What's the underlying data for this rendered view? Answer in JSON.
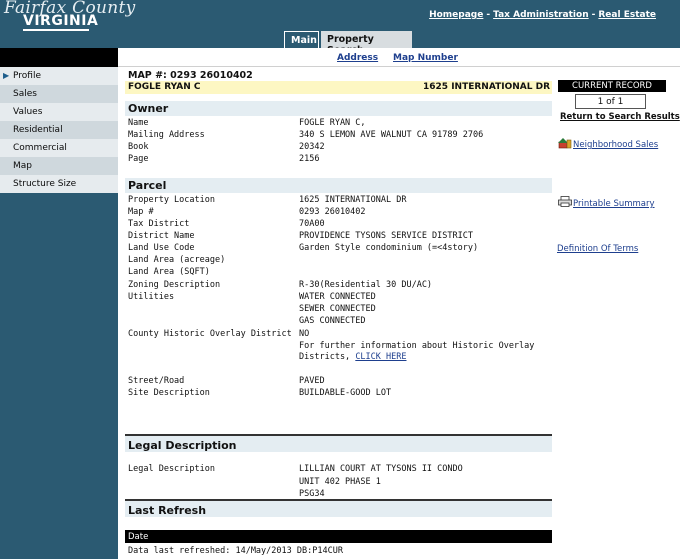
{
  "header": {
    "logo_county": "Fairfax County",
    "logo_state": "VIRGINIA",
    "nav": [
      "Homepage",
      "Tax Administration",
      "Real Estate"
    ],
    "tabs": [
      "Main",
      "Property Search"
    ]
  },
  "subnav": {
    "address": "Address",
    "map_number": "Map Number"
  },
  "sidebar": {
    "items": [
      {
        "label": "Profile"
      },
      {
        "label": "Sales"
      },
      {
        "label": "Values"
      },
      {
        "label": "Residential"
      },
      {
        "label": "Commercial"
      },
      {
        "label": "Map"
      },
      {
        "label": "Structure Size"
      }
    ]
  },
  "record": {
    "map_label": "MAP #: 0293 26010402",
    "owner_name": "FOGLE RYAN C",
    "address": "1625 INTERNATIONAL DR"
  },
  "owner": {
    "title": "Owner",
    "rows": [
      {
        "k": "Name",
        "v": "FOGLE RYAN C,"
      },
      {
        "k": "Mailing Address",
        "v": "340 S LEMON AVE WALNUT CA 91789 2706"
      },
      {
        "k": "Book",
        "v": "20342"
      },
      {
        "k": "Page",
        "v": "2156"
      }
    ]
  },
  "parcel": {
    "title": "Parcel",
    "rows": [
      {
        "k": "Property Location",
        "v": "1625 INTERNATIONAL DR"
      },
      {
        "k": "Map #",
        "v": "0293 26010402"
      },
      {
        "k": "Tax District",
        "v": "70A00"
      },
      {
        "k": "District Name",
        "v": "PROVIDENCE TYSONS SERVICE DISTRICT"
      },
      {
        "k": "Land Use Code",
        "v": "Garden Style condominium (=<4story)"
      },
      {
        "k": "Land Area (acreage)",
        "v": ""
      },
      {
        "k": "Land Area (SQFT)",
        "v": ""
      },
      {
        "k": "Zoning Description",
        "v": "R-30(Residential 30 DU/AC)"
      },
      {
        "k": "Utilities",
        "v": "WATER CONNECTED"
      },
      {
        "k": "",
        "v": "SEWER CONNECTED"
      },
      {
        "k": "",
        "v": "GAS CONNECTED"
      },
      {
        "k": "County Historic Overlay District",
        "v": "NO"
      },
      {
        "k": "",
        "v": "For further information about Historic Overlay"
      },
      {
        "k": "",
        "v": "Districts,"
      },
      {
        "k": "Street/Road",
        "v": "PAVED"
      },
      {
        "k": "Site Description",
        "v": "BUILDABLE-GOOD LOT"
      }
    ],
    "click_here": "CLICK HERE"
  },
  "legal": {
    "title": "Legal Description",
    "label": "Legal Description",
    "lines": [
      "LILLIAN COURT AT TYSONS II CONDO",
      "UNIT 402 PHASE 1",
      "PSG34"
    ]
  },
  "refresh": {
    "title": "Last Refresh",
    "date_header": "Date",
    "text": "Data last refreshed: 14/May/2013 DB:P14CUR"
  },
  "right": {
    "current_record": "CURRENT RECORD",
    "record_count": "1 of 1",
    "return_link": "Return to Search Results",
    "neighborhood_sales": "Neighborhood Sales",
    "printable_summary": "Printable Summary",
    "definition_of_terms": "Definition Of Terms"
  }
}
